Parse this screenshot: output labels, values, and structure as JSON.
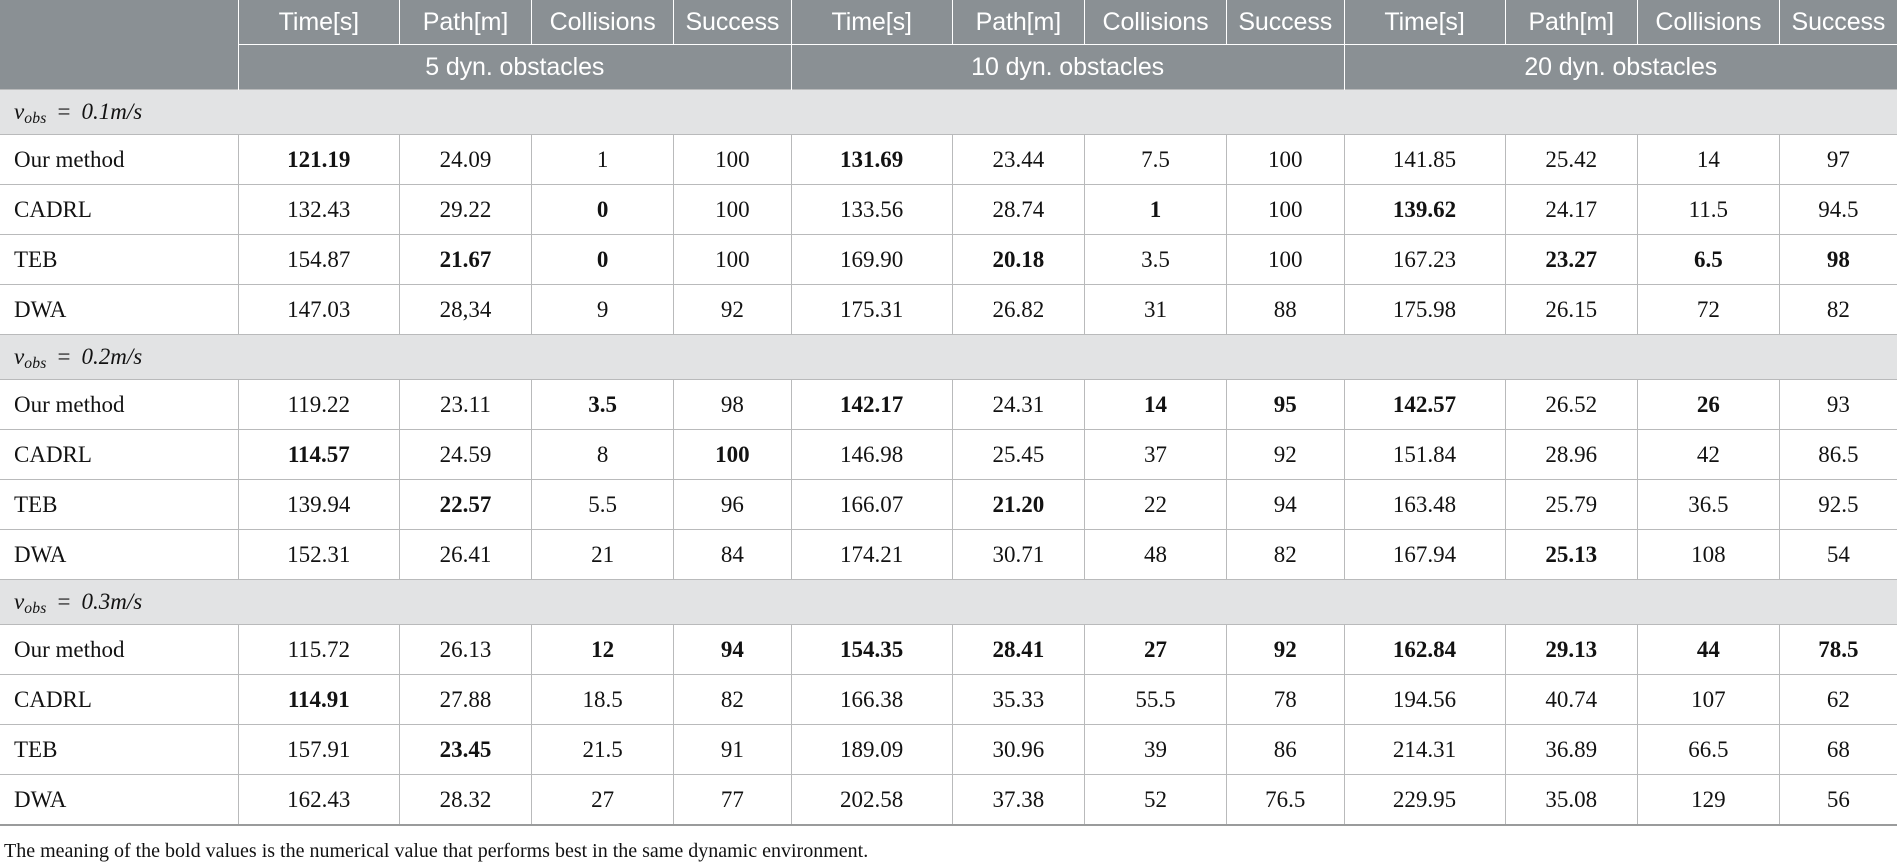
{
  "header": {
    "corner_label": "",
    "metrics": [
      "Time[s]",
      "Path[m]",
      "Collisions",
      "Success"
    ],
    "groups": [
      "5 dyn. obstacles",
      "10 dyn. obstacles",
      "20 dyn. obstacles"
    ]
  },
  "footnote": "The meaning of the bold values is the numerical value that performs best in the same dynamic environment.",
  "colors": {
    "header_bg": "#8a9094",
    "header_text": "#ffffff",
    "section_bg": "#e2e3e4",
    "grid_line": "#b9babb",
    "body_bg": "#ffffff",
    "body_text": "#121212"
  },
  "chart_data": {
    "type": "table",
    "title": "",
    "row_groups": [
      {
        "label_prefix": "v",
        "label_sub": "obs",
        "label_eq": "=",
        "label_value": "0.1m/s",
        "label_plain": "v_obs = 0.1m/s",
        "rows": [
          {
            "method": "Our method",
            "cells": [
              {
                "v": "121.19",
                "bold": true
              },
              {
                "v": "24.09",
                "bold": false
              },
              {
                "v": "1",
                "bold": false
              },
              {
                "v": "100",
                "bold": false
              },
              {
                "v": "131.69",
                "bold": true
              },
              {
                "v": "23.44",
                "bold": false
              },
              {
                "v": "7.5",
                "bold": false
              },
              {
                "v": "100",
                "bold": false
              },
              {
                "v": "141.85",
                "bold": false
              },
              {
                "v": "25.42",
                "bold": false
              },
              {
                "v": "14",
                "bold": false
              },
              {
                "v": "97",
                "bold": false
              }
            ]
          },
          {
            "method": "CADRL",
            "cells": [
              {
                "v": "132.43",
                "bold": false
              },
              {
                "v": "29.22",
                "bold": false
              },
              {
                "v": "0",
                "bold": true
              },
              {
                "v": "100",
                "bold": false
              },
              {
                "v": "133.56",
                "bold": false
              },
              {
                "v": "28.74",
                "bold": false
              },
              {
                "v": "1",
                "bold": true
              },
              {
                "v": "100",
                "bold": false
              },
              {
                "v": "139.62",
                "bold": true
              },
              {
                "v": "24.17",
                "bold": false
              },
              {
                "v": "11.5",
                "bold": false
              },
              {
                "v": "94.5",
                "bold": false
              }
            ]
          },
          {
            "method": "TEB",
            "cells": [
              {
                "v": "154.87",
                "bold": false
              },
              {
                "v": "21.67",
                "bold": true
              },
              {
                "v": "0",
                "bold": true
              },
              {
                "v": "100",
                "bold": false
              },
              {
                "v": "169.90",
                "bold": false
              },
              {
                "v": "20.18",
                "bold": true
              },
              {
                "v": "3.5",
                "bold": false
              },
              {
                "v": "100",
                "bold": false
              },
              {
                "v": "167.23",
                "bold": false
              },
              {
                "v": "23.27",
                "bold": true
              },
              {
                "v": "6.5",
                "bold": true
              },
              {
                "v": "98",
                "bold": true
              }
            ]
          },
          {
            "method": "DWA",
            "cells": [
              {
                "v": "147.03",
                "bold": false
              },
              {
                "v": "28,34",
                "bold": false
              },
              {
                "v": "9",
                "bold": false
              },
              {
                "v": "92",
                "bold": false
              },
              {
                "v": "175.31",
                "bold": false
              },
              {
                "v": "26.82",
                "bold": false
              },
              {
                "v": "31",
                "bold": false
              },
              {
                "v": "88",
                "bold": false
              },
              {
                "v": "175.98",
                "bold": false
              },
              {
                "v": "26.15",
                "bold": false
              },
              {
                "v": "72",
                "bold": false
              },
              {
                "v": "82",
                "bold": false
              }
            ]
          }
        ]
      },
      {
        "label_prefix": "v",
        "label_sub": "obs",
        "label_eq": "=",
        "label_value": "0.2m/s",
        "label_plain": "v_obs = 0.2m/s",
        "rows": [
          {
            "method": "Our method",
            "cells": [
              {
                "v": "119.22",
                "bold": false
              },
              {
                "v": "23.11",
                "bold": false
              },
              {
                "v": "3.5",
                "bold": true
              },
              {
                "v": "98",
                "bold": false
              },
              {
                "v": "142.17",
                "bold": true
              },
              {
                "v": "24.31",
                "bold": false
              },
              {
                "v": "14",
                "bold": true
              },
              {
                "v": "95",
                "bold": true
              },
              {
                "v": "142.57",
                "bold": true
              },
              {
                "v": "26.52",
                "bold": false
              },
              {
                "v": "26",
                "bold": true
              },
              {
                "v": "93",
                "bold": false
              }
            ]
          },
          {
            "method": "CADRL",
            "cells": [
              {
                "v": "114.57",
                "bold": true
              },
              {
                "v": "24.59",
                "bold": false
              },
              {
                "v": "8",
                "bold": false
              },
              {
                "v": "100",
                "bold": true
              },
              {
                "v": "146.98",
                "bold": false
              },
              {
                "v": "25.45",
                "bold": false
              },
              {
                "v": "37",
                "bold": false
              },
              {
                "v": "92",
                "bold": false
              },
              {
                "v": "151.84",
                "bold": false
              },
              {
                "v": "28.96",
                "bold": false
              },
              {
                "v": "42",
                "bold": false
              },
              {
                "v": "86.5",
                "bold": false
              }
            ]
          },
          {
            "method": "TEB",
            "cells": [
              {
                "v": "139.94",
                "bold": false
              },
              {
                "v": "22.57",
                "bold": true
              },
              {
                "v": "5.5",
                "bold": false
              },
              {
                "v": "96",
                "bold": false
              },
              {
                "v": "166.07",
                "bold": false
              },
              {
                "v": "21.20",
                "bold": true
              },
              {
                "v": "22",
                "bold": false
              },
              {
                "v": "94",
                "bold": false
              },
              {
                "v": "163.48",
                "bold": false
              },
              {
                "v": "25.79",
                "bold": false
              },
              {
                "v": "36.5",
                "bold": false
              },
              {
                "v": "92.5",
                "bold": false
              }
            ]
          },
          {
            "method": "DWA",
            "cells": [
              {
                "v": "152.31",
                "bold": false
              },
              {
                "v": "26.41",
                "bold": false
              },
              {
                "v": "21",
                "bold": false
              },
              {
                "v": "84",
                "bold": false
              },
              {
                "v": "174.21",
                "bold": false
              },
              {
                "v": "30.71",
                "bold": false
              },
              {
                "v": "48",
                "bold": false
              },
              {
                "v": "82",
                "bold": false
              },
              {
                "v": "167.94",
                "bold": false
              },
              {
                "v": "25.13",
                "bold": true
              },
              {
                "v": "108",
                "bold": false
              },
              {
                "v": "54",
                "bold": false
              }
            ]
          }
        ]
      },
      {
        "label_prefix": "v",
        "label_sub": "obs",
        "label_eq": "=",
        "label_value": "0.3m/s",
        "label_plain": "v_obs = 0.3m/s",
        "rows": [
          {
            "method": "Our method",
            "cells": [
              {
                "v": "115.72",
                "bold": false
              },
              {
                "v": "26.13",
                "bold": false
              },
              {
                "v": "12",
                "bold": true
              },
              {
                "v": "94",
                "bold": true
              },
              {
                "v": "154.35",
                "bold": true
              },
              {
                "v": "28.41",
                "bold": true
              },
              {
                "v": "27",
                "bold": true
              },
              {
                "v": "92",
                "bold": true
              },
              {
                "v": "162.84",
                "bold": true
              },
              {
                "v": "29.13",
                "bold": true
              },
              {
                "v": "44",
                "bold": true
              },
              {
                "v": "78.5",
                "bold": true
              }
            ]
          },
          {
            "method": "CADRL",
            "cells": [
              {
                "v": "114.91",
                "bold": true
              },
              {
                "v": "27.88",
                "bold": false
              },
              {
                "v": "18.5",
                "bold": false
              },
              {
                "v": "82",
                "bold": false
              },
              {
                "v": "166.38",
                "bold": false
              },
              {
                "v": "35.33",
                "bold": false
              },
              {
                "v": "55.5",
                "bold": false
              },
              {
                "v": "78",
                "bold": false
              },
              {
                "v": "194.56",
                "bold": false
              },
              {
                "v": "40.74",
                "bold": false
              },
              {
                "v": "107",
                "bold": false
              },
              {
                "v": "62",
                "bold": false
              }
            ]
          },
          {
            "method": "TEB",
            "cells": [
              {
                "v": "157.91",
                "bold": false
              },
              {
                "v": "23.45",
                "bold": true
              },
              {
                "v": "21.5",
                "bold": false
              },
              {
                "v": "91",
                "bold": false
              },
              {
                "v": "189.09",
                "bold": false
              },
              {
                "v": "30.96",
                "bold": false
              },
              {
                "v": "39",
                "bold": false
              },
              {
                "v": "86",
                "bold": false
              },
              {
                "v": "214.31",
                "bold": false
              },
              {
                "v": "36.89",
                "bold": false
              },
              {
                "v": "66.5",
                "bold": false
              },
              {
                "v": "68",
                "bold": false
              }
            ]
          },
          {
            "method": "DWA",
            "cells": [
              {
                "v": "162.43",
                "bold": false
              },
              {
                "v": "28.32",
                "bold": false
              },
              {
                "v": "27",
                "bold": false
              },
              {
                "v": "77",
                "bold": false
              },
              {
                "v": "202.58",
                "bold": false
              },
              {
                "v": "37.38",
                "bold": false
              },
              {
                "v": "52",
                "bold": false
              },
              {
                "v": "76.5",
                "bold": false
              },
              {
                "v": "229.95",
                "bold": false
              },
              {
                "v": "35.08",
                "bold": false
              },
              {
                "v": "129",
                "bold": false
              },
              {
                "v": "56",
                "bold": false
              }
            ]
          }
        ]
      }
    ]
  }
}
